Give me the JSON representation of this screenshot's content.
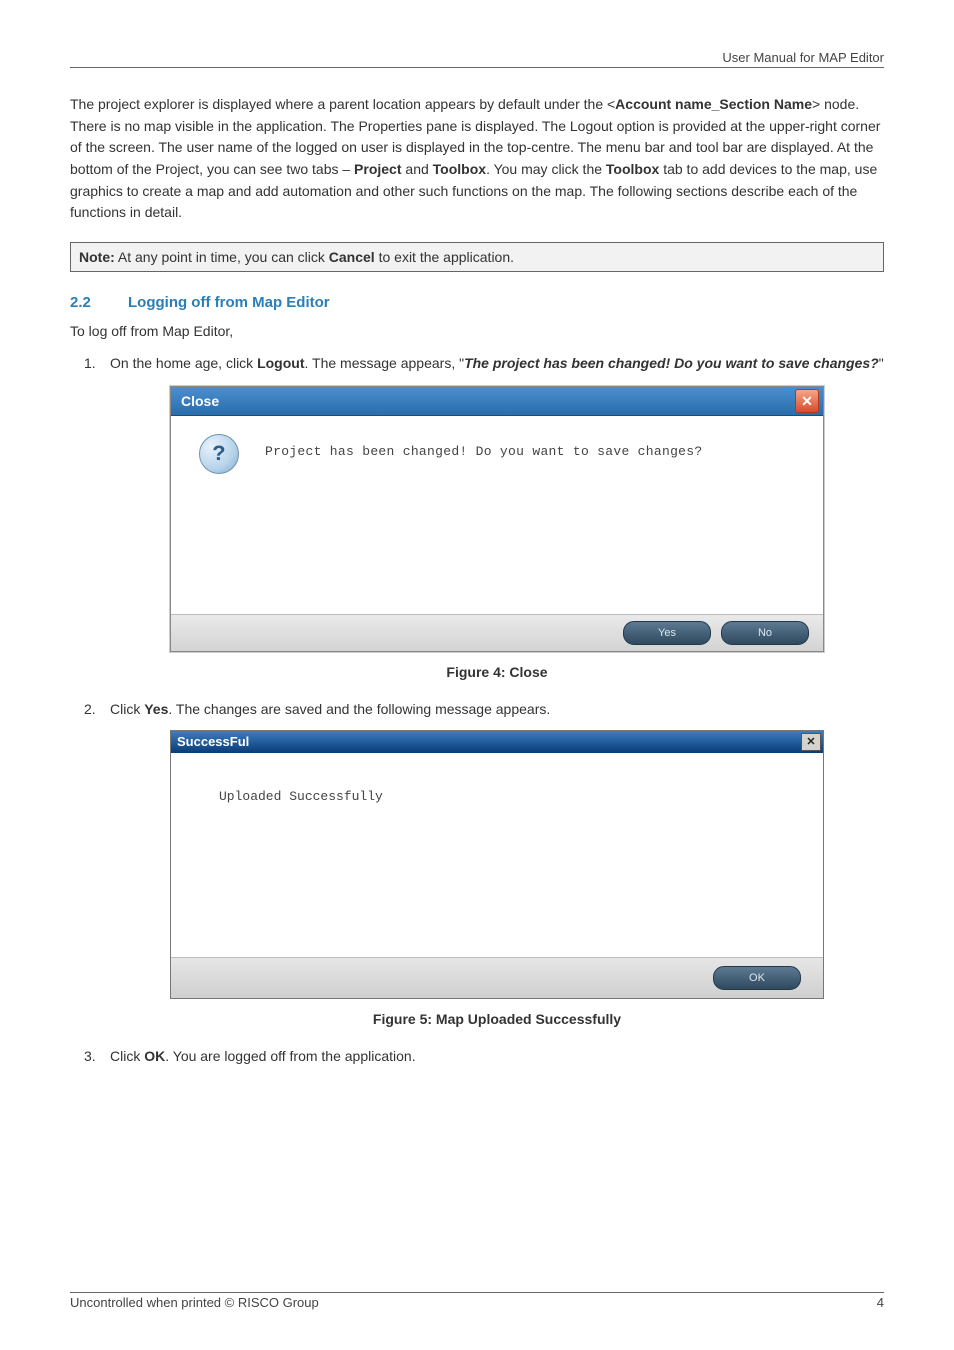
{
  "header": {
    "title": "User Manual for MAP Editor"
  },
  "para1_pre": "The project explorer is displayed where a parent location appears by default under the <",
  "para1_b1": "Account name_Section Name",
  "para1_mid1": "> node. There is no map visible in the application. The Properties pane is displayed. The Logout option is provided at the upper-right corner of the screen. The user name of the logged on user is displayed in the top-centre. The menu bar and tool bar are displayed. At the bottom of the Project, you can see two tabs – ",
  "para1_b2": "Project",
  "para1_mid2": " and ",
  "para1_b3": "Toolbox",
  "para1_mid3": ". You may click the ",
  "para1_b4": "Toolbox",
  "para1_post": " tab to add devices to the map, use graphics to create a map and add automation and other such functions on the map. The following sections describe each of the functions in detail.",
  "note_b1": "Note:",
  "note_mid": " At any point in time, you can click ",
  "note_b2": "Cancel",
  "note_post": " to exit the application.",
  "section": {
    "num": "2.2",
    "title": "Logging off from Map Editor"
  },
  "intro": "To log off from Map Editor,",
  "step1_pre": "On the home age, click ",
  "step1_b1": "Logout",
  "step1_mid": ". The message appears, \"",
  "step1_bi": "The project has been changed! Do you want to save changes?",
  "step1_post": "\"",
  "dialog1": {
    "title": "Close",
    "message": "Project has been changed!   Do you want to save changes?",
    "yes": "Yes",
    "no": "No",
    "qmark": "?"
  },
  "caption1": "Figure 4: Close",
  "step2_pre": "Click ",
  "step2_b1": "Yes",
  "step2_post": ". The changes are saved and the following message appears.",
  "dialog2": {
    "title": "SuccessFul",
    "message": "Uploaded Successfully",
    "ok": "OK"
  },
  "caption2": "Figure 5: Map Uploaded Successfully",
  "step3_pre": "Click ",
  "step3_b1": "OK",
  "step3_post": ". You are logged off from the application.",
  "footer": {
    "left": "Uncontrolled when printed © RISCO Group",
    "right": "4"
  }
}
